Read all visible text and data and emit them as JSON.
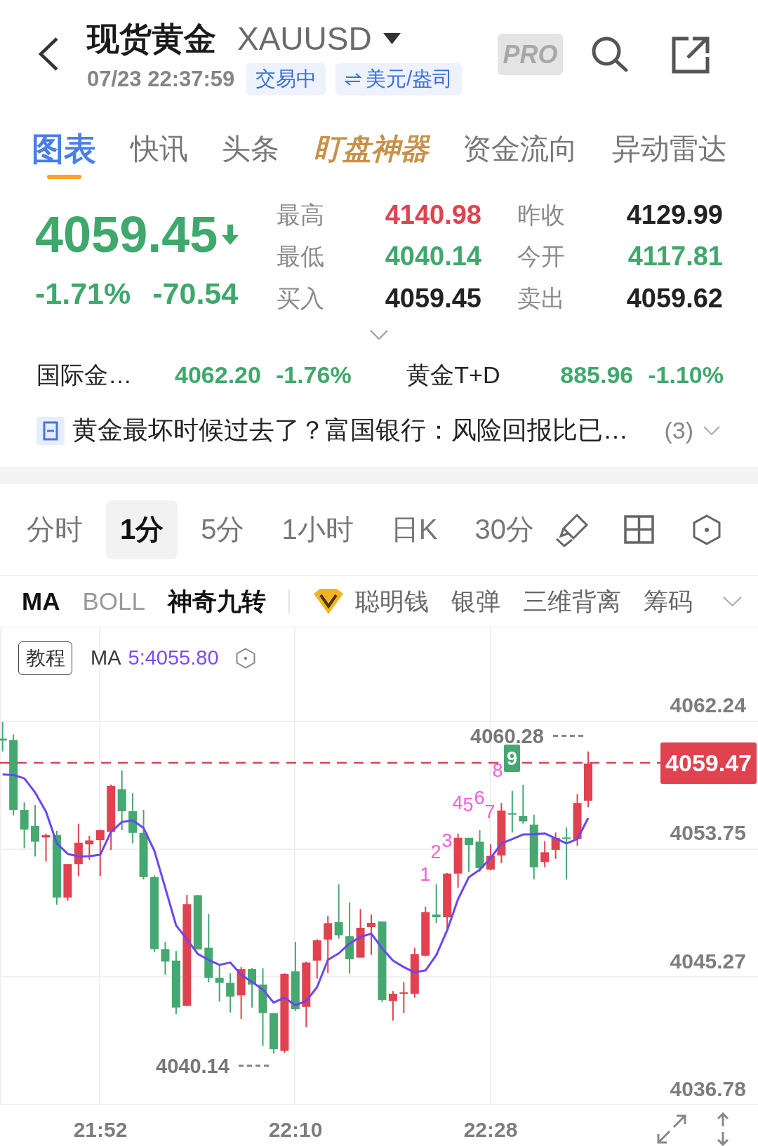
{
  "header": {
    "title": "现货黄金",
    "symbol": "XAUUSD",
    "datetime": "07/23 22:37:59",
    "status": "交易中",
    "unit": "美元/盎司",
    "pro_badge": "PRO"
  },
  "tabs": [
    {
      "label": "图表",
      "selected": true,
      "kind": "plain"
    },
    {
      "label": "快讯",
      "selected": false,
      "kind": "plain"
    },
    {
      "label": "头条",
      "selected": false,
      "kind": "plain"
    },
    {
      "label": "盯盘神器",
      "selected": false,
      "kind": "featured"
    },
    {
      "label": "资金流向",
      "selected": false,
      "kind": "plain"
    },
    {
      "label": "异动雷达",
      "selected": false,
      "kind": "plain"
    }
  ],
  "quote": {
    "price": "4059.45",
    "falling": true,
    "change_percent": "-1.71%",
    "change": "-70.54"
  },
  "stats": [
    {
      "label": "最高",
      "value": "4140.98",
      "color": "#e0424f"
    },
    {
      "label": "昨收",
      "value": "4129.99",
      "color": "#222222"
    },
    {
      "label": "最低",
      "value": "4040.14",
      "color": "#3fa86c"
    },
    {
      "label": "今开",
      "value": "4117.81",
      "color": "#3fa86c"
    },
    {
      "label": "买入",
      "value": "4059.45",
      "color": "#222222"
    },
    {
      "label": "卖出",
      "value": "4059.62",
      "color": "#222222"
    }
  ],
  "related": [
    {
      "name": "国际金…",
      "price": "4062.20",
      "change": "-1.76%",
      "color": "#3fa86c"
    },
    {
      "name": "黄金T+D",
      "price": "885.96",
      "change": "-1.10%",
      "color": "#3fa86c"
    }
  ],
  "news": {
    "headline": "黄金最坏时候过去了？富国银行：风险回报比已…",
    "count": "(3)"
  },
  "periods": [
    {
      "label": "分时",
      "selected": false
    },
    {
      "label": "1分",
      "selected": true
    },
    {
      "label": "5分",
      "selected": false
    },
    {
      "label": "1小时",
      "selected": false
    },
    {
      "label": "日K",
      "selected": false
    },
    {
      "label": "30分",
      "selected": false
    }
  ],
  "indicators": [
    {
      "label": "MA",
      "selected": true
    },
    {
      "label": "BOLL",
      "selected": false
    },
    {
      "label": "神奇九转",
      "selected": true
    }
  ],
  "smart_indicators": [
    {
      "label": "聪明钱",
      "selected": false
    },
    {
      "label": "银弹",
      "selected": false
    },
    {
      "label": "三维背离",
      "selected": false
    },
    {
      "label": "筹码",
      "selected": false
    }
  ],
  "chart": {
    "tutorial_button": "教程",
    "ma_name": "MA",
    "ma_value": "5:4055.80",
    "high_marker": "4060.28",
    "current_price": "4059.47",
    "low_marker": "4040.14",
    "price_axis": [
      "4062.24",
      "4053.75",
      "4045.27",
      "4036.78"
    ],
    "time_axis": [
      "21:52",
      "22:10",
      "22:28"
    ],
    "sequence": [
      {
        "text": "1",
        "kind": "count"
      },
      {
        "text": "2",
        "kind": "count"
      },
      {
        "text": "3",
        "kind": "count"
      },
      {
        "text": "4",
        "kind": "count"
      },
      {
        "text": "5",
        "kind": "count"
      },
      {
        "text": "6",
        "kind": "count"
      },
      {
        "text": "7",
        "kind": "count"
      },
      {
        "text": "8",
        "kind": "count"
      },
      {
        "text": "9",
        "kind": "signal"
      }
    ]
  }
}
